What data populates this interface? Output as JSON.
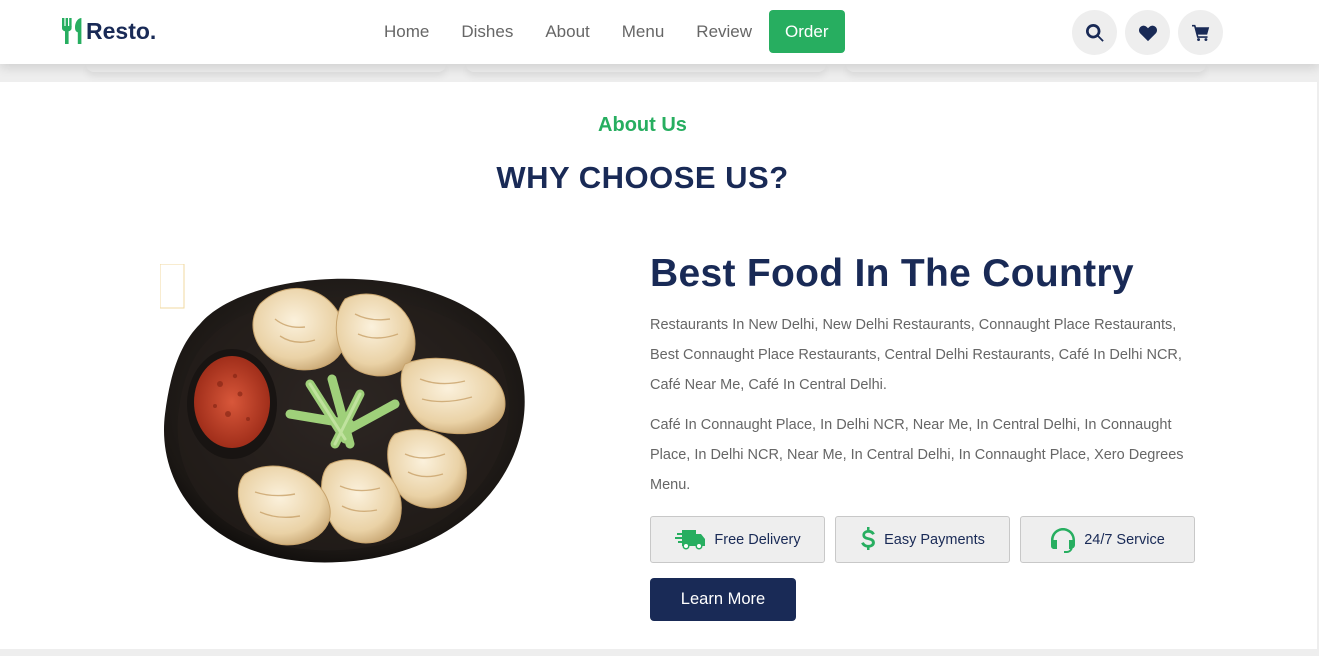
{
  "brand": {
    "name": "Resto.",
    "icon": "utensils-icon",
    "color": "#192a56",
    "accent": "#27ae60"
  },
  "nav": {
    "items": [
      {
        "label": "Home"
      },
      {
        "label": "Dishes"
      },
      {
        "label": "About"
      },
      {
        "label": "Menu"
      },
      {
        "label": "Review"
      },
      {
        "label": "Order"
      }
    ],
    "active_label": "Order"
  },
  "header_icons": [
    "search-icon",
    "heart-icon",
    "cart-icon"
  ],
  "about": {
    "subheading": "About Us",
    "heading": "WHY CHOOSE US?",
    "title": "Best Food In The Country",
    "paragraph1": "Restaurants In New Delhi, New Delhi Restaurants, Connaught Place Restaurants, Best Connaught Place Restaurants, Central Delhi Restaurants, Café In Delhi NCR, Café Near Me, Café In Central Delhi.",
    "paragraph2": "Café In Connaught Place, In Delhi NCR, Near Me, In Central Delhi, In Connaught Place, In Delhi NCR, Near Me, In Central Delhi, In Connaught Place, Xero Degrees Menu.",
    "features": [
      {
        "icon": "shipping-fast-icon",
        "label": "Free Delivery"
      },
      {
        "icon": "dollar-sign-icon",
        "label": "Easy Payments"
      },
      {
        "icon": "headset-icon",
        "label": "24/7 Service"
      }
    ],
    "button_label": "Learn More"
  }
}
